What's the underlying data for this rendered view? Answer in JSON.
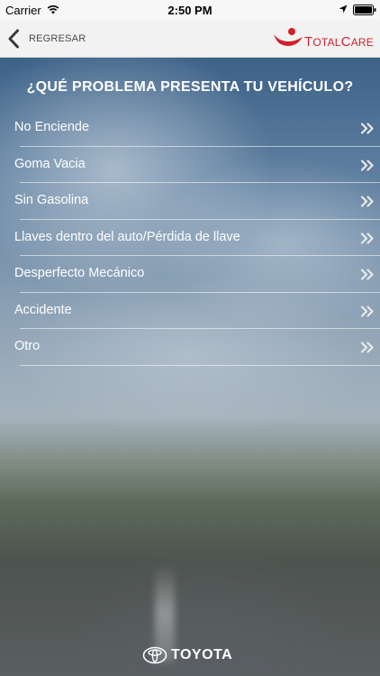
{
  "status_bar": {
    "carrier": "Carrier",
    "time": "2:50 PM",
    "wifi_icon": "wifi-icon",
    "location_icon": "location-arrow-icon",
    "battery_icon": "battery-icon"
  },
  "nav": {
    "back_label": "REGRESAR",
    "back_icon": "chevron-left-icon",
    "logo": {
      "text_part1_cap": "T",
      "text_part1": "OTAL",
      "text_part2_cap": "C",
      "text_part2": "ARE",
      "color": "#d31f2a"
    }
  },
  "main": {
    "title": "¿QUÉ PROBLEMA PRESENTA TU VEHÍCULO?",
    "items": [
      {
        "label": "No Enciende"
      },
      {
        "label": "Goma Vacia"
      },
      {
        "label": "Sin Gasolina"
      },
      {
        "label": "Llaves dentro del auto/Pérdida de llave"
      },
      {
        "label": "Desperfecto Mecánico"
      },
      {
        "label": "Accidente"
      },
      {
        "label": "Otro"
      }
    ],
    "item_icon": "double-chevron-right-icon"
  },
  "footer": {
    "brand": "TOYOTA",
    "emblem_icon": "toyota-emblem-icon"
  }
}
